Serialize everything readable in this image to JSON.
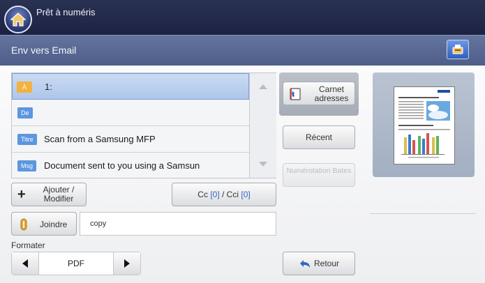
{
  "status_bar": {
    "text": "Prêt à numéris"
  },
  "title_bar": {
    "title": "Env vers Email"
  },
  "recipients": [
    {
      "tag": "À",
      "value": "1:"
    },
    {
      "tag": "De",
      "value": ""
    },
    {
      "tag": "Titre",
      "value": "Scan from a Samsung MFP"
    },
    {
      "tag": "Msg",
      "value": "Document sent to you using a Samsun"
    }
  ],
  "buttons": {
    "add_modify": "Ajouter / Modifier",
    "cc_label": "Cc",
    "cc_count": "[0]",
    "cci_label": "Cci",
    "cci_count": "[0]",
    "attach": "Joindre",
    "address_book": "Carnet adresses",
    "recent": "Récent",
    "bates_numbering": "Numérotation Bates",
    "back": "Retour"
  },
  "attachment": {
    "filename": "copy"
  },
  "format": {
    "label": "Formater",
    "value": "PDF"
  },
  "colors": {
    "accent": "#5c96df",
    "to_tag": "#f3b23d",
    "header_dark": "#1c2242",
    "title_bar": "#4e5d88"
  },
  "icons": [
    "home-icon",
    "job-status-icon",
    "scroll-up-icon",
    "scroll-down-icon",
    "plus-icon",
    "paperclip-icon",
    "address-book-icon",
    "arrow-left-icon",
    "arrow-right-icon",
    "undo-arrow-icon"
  ]
}
